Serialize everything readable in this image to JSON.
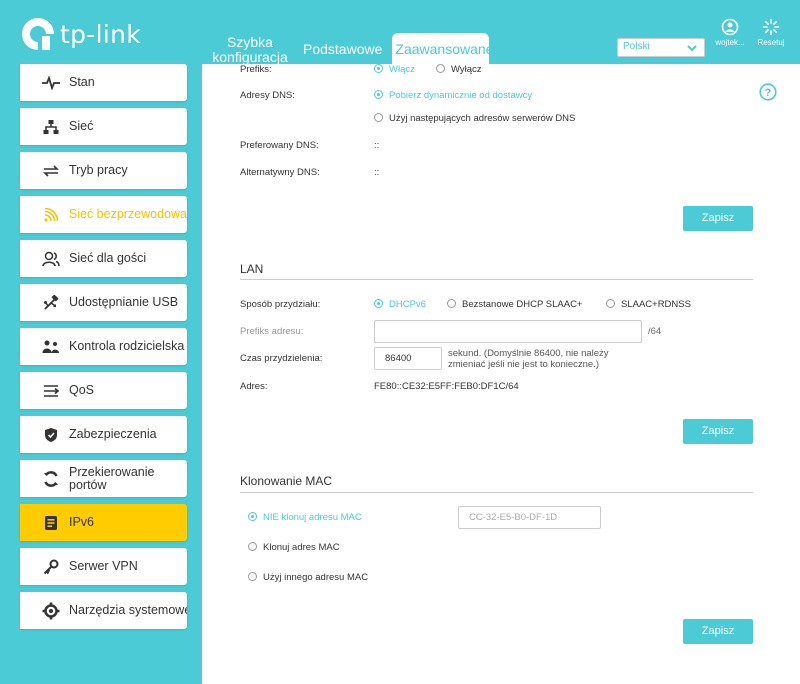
{
  "brand": {
    "name": "tp-link"
  },
  "header": {
    "tabs": [
      {
        "label": "Szybka konfiguracja"
      },
      {
        "label": "Podstawowe"
      },
      {
        "label": "Zaawansowane"
      }
    ],
    "language": "Polski",
    "user_label": "wojtek...",
    "reset_label": "Resetuj"
  },
  "sidebar": {
    "items": [
      {
        "label": "Stan"
      },
      {
        "label": "Sieć"
      },
      {
        "label": "Tryb pracy"
      },
      {
        "label": "Sieć bezprzewodowa"
      },
      {
        "label": "Sieć dla gości"
      },
      {
        "label": "Udostępnianie USB"
      },
      {
        "label": "Kontrola rodzicielska"
      },
      {
        "label": "QoS"
      },
      {
        "label": "Zabezpieczenia"
      },
      {
        "label": "Przekierowanie portów"
      },
      {
        "label": "IPv6"
      },
      {
        "label": "Serwer VPN"
      },
      {
        "label": "Narzędzia systemowe"
      }
    ]
  },
  "wan": {
    "prefix_label": "Prefiks:",
    "prefix_on": "Włącz",
    "prefix_off": "Wyłącz",
    "dns_label": "Adresy DNS:",
    "dns_dynamic": "Pobierz dynamicznie od dostawcy",
    "dns_manual": "Użyj następujących adresów serwerów DNS",
    "preferred_dns_label": "Preferowany DNS:",
    "preferred_dns_value": "::",
    "alternate_dns_label": "Alternatywny DNS:",
    "alternate_dns_value": "::",
    "save": "Zapisz"
  },
  "lan": {
    "title": "LAN",
    "assign_label": "Sposób przydziału:",
    "assign_dhcpv6": "DHCPv6",
    "assign_stateless": "Bezstanowe DHCP SLAAC+",
    "assign_slaac": "SLAAC+RDNSS",
    "prefix_label": "Prefiks adresu:",
    "prefix_value": "",
    "prefix_suffix": "/64",
    "lease_label": "Czas przydzielenia:",
    "lease_value": "86400",
    "lease_hint": "sekund. (Domyślnie 86400, nie należy zmieniać jeśli nie jest to konieczne.)",
    "address_label": "Adres:",
    "address_value": "FE80::CE32:E5FF:FEB0:DF1C/64",
    "save": "Zapisz"
  },
  "mac": {
    "title": "Klonowanie MAC",
    "opt_no_clone": "NIE klonuj adresu MAC",
    "mac_value": "CC-32-E5-B0-DF-1D",
    "opt_clone": "Klonuj adres MAC",
    "opt_custom": "Użyj innego adresu MAC",
    "save": "Zapisz"
  }
}
